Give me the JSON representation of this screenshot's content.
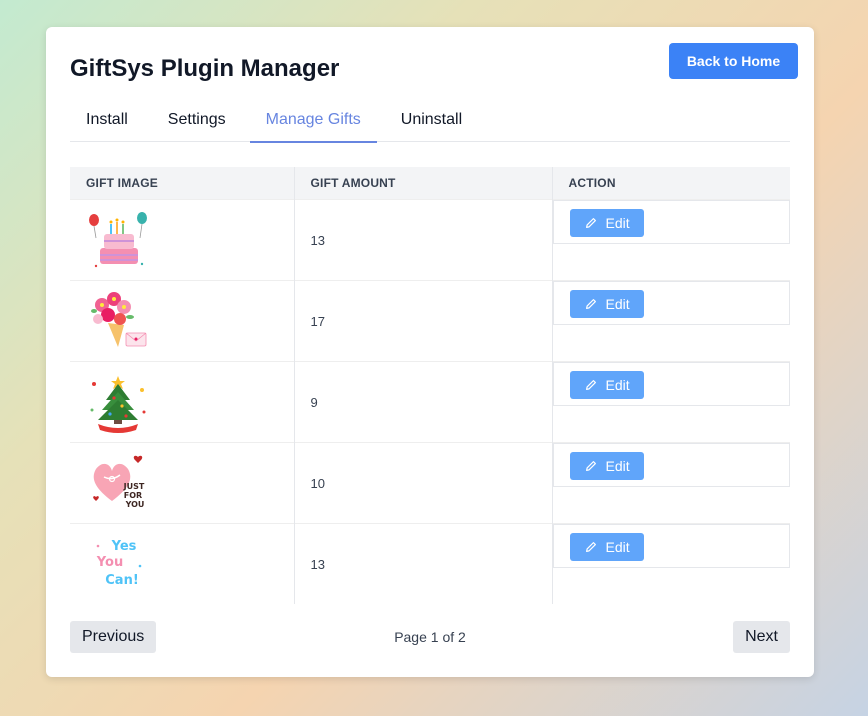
{
  "header": {
    "title": "GiftSys Plugin Manager",
    "back_label": "Back to Home"
  },
  "tabs": [
    {
      "label": "Install",
      "active": false
    },
    {
      "label": "Settings",
      "active": false
    },
    {
      "label": "Manage Gifts",
      "active": true
    },
    {
      "label": "Uninstall",
      "active": false
    }
  ],
  "table": {
    "columns": [
      "GIFT IMAGE",
      "GIFT AMOUNT",
      "ACTION"
    ],
    "rows": [
      {
        "image": "birthday-cake-image",
        "amount": "13",
        "action": "Edit"
      },
      {
        "image": "flower-bouquet-image",
        "amount": "17",
        "action": "Edit"
      },
      {
        "image": "christmas-tree-image",
        "amount": "9",
        "action": "Edit"
      },
      {
        "image": "heart-just-for-you-image",
        "amount": "10",
        "action": "Edit"
      },
      {
        "image": "yes-you-can-image",
        "amount": "13",
        "action": "Edit"
      }
    ]
  },
  "images": {
    "heart_text_1": "JUST",
    "heart_text_2": "FOR",
    "heart_text_3": "YOU",
    "yes_text_1": "Yes",
    "yes_text_2": "You",
    "yes_text_3": "Can!"
  },
  "pagination": {
    "previous_label": "Previous",
    "page_info": "Page 1 of 2",
    "next_label": "Next"
  },
  "colors": {
    "primary": "#3b82f6",
    "edit_button": "#60a5fa",
    "active_tab": "#6785e0"
  },
  "icons": {
    "edit": "pencil-icon"
  }
}
